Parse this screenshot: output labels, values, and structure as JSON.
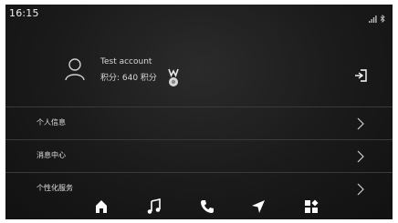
{
  "status_bar": {
    "time": "16:15",
    "signal_icon": "cellular-signal-icon",
    "bluetooth_icon": "bluetooth-icon"
  },
  "profile": {
    "account_name": "Test account",
    "points_text": "积分: 640 积分",
    "avatar_icon": "user-outline-icon",
    "medal_icon": "medal-icon",
    "logout_icon": "logout-icon"
  },
  "menu": {
    "items": [
      {
        "label": "个人信息",
        "icon": "chevron-right-icon"
      },
      {
        "label": "消息中心",
        "icon": "chevron-right-icon"
      },
      {
        "label": "个性化服务",
        "icon": "chevron-right-icon"
      }
    ]
  },
  "bottom_nav": {
    "items": [
      {
        "icon": "home-icon"
      },
      {
        "icon": "music-icon"
      },
      {
        "icon": "phone-icon"
      },
      {
        "icon": "navigation-icon"
      },
      {
        "icon": "apps-icon"
      }
    ]
  },
  "colors": {
    "background": "#1a1a1a",
    "text": "#e6e6e6",
    "divider": "#3a3a3a"
  }
}
